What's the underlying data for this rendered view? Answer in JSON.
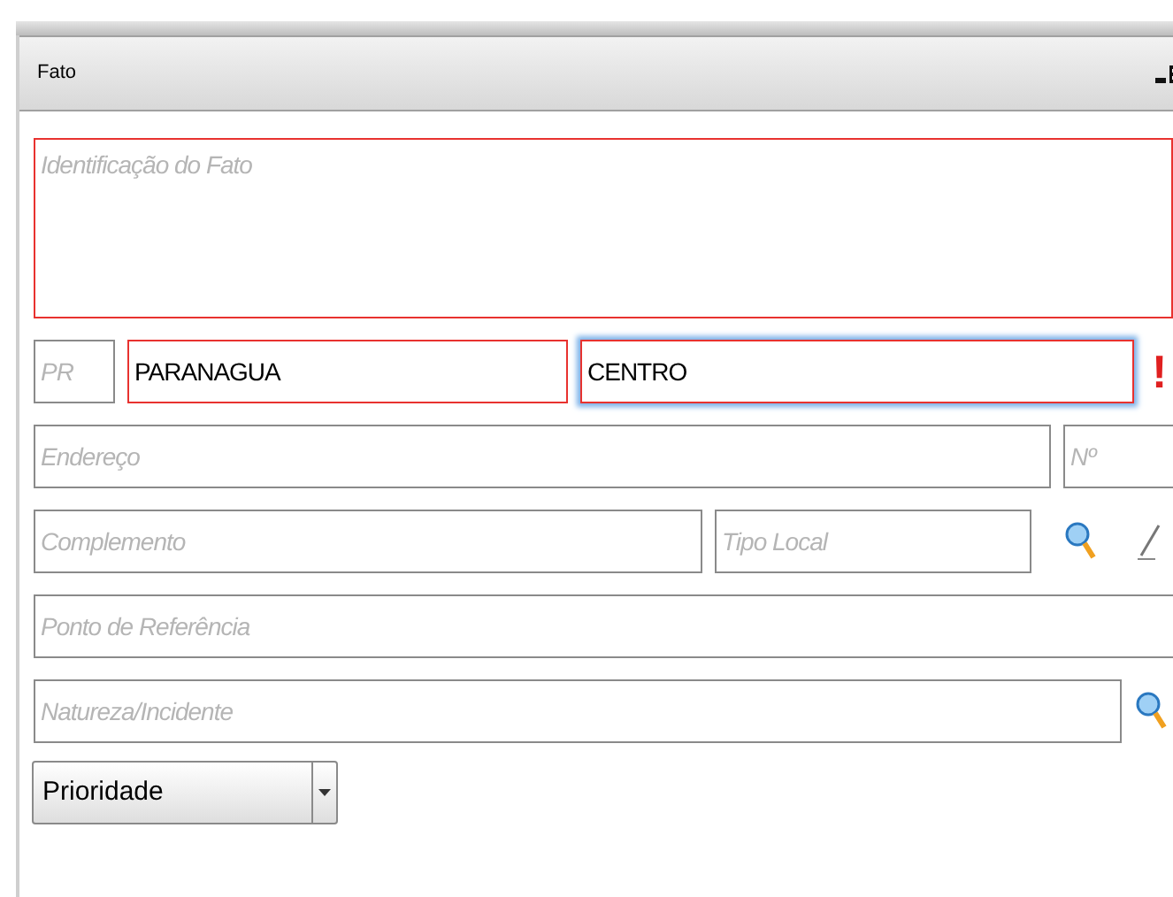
{
  "panel": {
    "title": "Fato"
  },
  "rows": [
    [
      {
        "kind": "textarea",
        "placeholder": "Identificação do Fato",
        "invalid": true,
        "focused": false
      }
    ],
    [
      {
        "kind": "input",
        "placeholder": "PR",
        "invalid": false,
        "focused": false
      },
      {
        "kind": "input",
        "value": "PARANAGUA",
        "invalid": true,
        "focused": false
      },
      {
        "kind": "input",
        "value": "CENTRO",
        "invalid": true,
        "focused": true
      },
      {
        "kind": "alert",
        "text": "!"
      }
    ],
    [
      {
        "kind": "input",
        "placeholder": "Endereço",
        "invalid": false,
        "focused": false
      },
      {
        "kind": "input",
        "placeholder": "Nº",
        "invalid": false,
        "focused": false
      }
    ],
    [
      {
        "kind": "input",
        "placeholder": "Complemento",
        "invalid": false,
        "focused": false
      },
      {
        "kind": "input",
        "placeholder": "Tipo Local",
        "invalid": false,
        "focused": false
      },
      {
        "kind": "search"
      },
      {
        "kind": "edit"
      }
    ],
    [
      {
        "kind": "input",
        "placeholder": "Ponto de Referência",
        "invalid": false,
        "focused": false
      }
    ],
    [
      {
        "kind": "input",
        "placeholder": "Natureza/Incidente",
        "invalid": false,
        "focused": false
      },
      {
        "kind": "search"
      }
    ],
    [
      {
        "kind": "select",
        "value": "Prioridade"
      }
    ]
  ]
}
